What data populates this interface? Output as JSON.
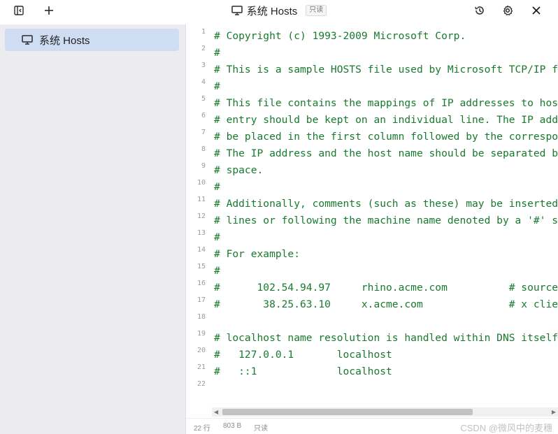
{
  "titlebar": {
    "title": "系统 Hosts",
    "readonly_badge": "只读",
    "icons": [
      "sidebar-toggle-icon",
      "plus-icon",
      "monitor-icon",
      "history-icon",
      "gear-icon",
      "close-icon"
    ]
  },
  "sidebar": {
    "items": [
      {
        "label": "系统 Hosts",
        "icon": "monitor-icon",
        "selected": true
      }
    ]
  },
  "editor": {
    "lines": [
      {
        "num": "1",
        "text": "# Copyright (c) 1993-2009 Microsoft Corp."
      },
      {
        "num": "2",
        "text": "#"
      },
      {
        "num": "3",
        "text": "# This is a sample HOSTS file used by Microsoft TCP/IP f"
      },
      {
        "num": "4",
        "text": "#"
      },
      {
        "num": "5",
        "text": "# This file contains the mappings of IP addresses to hos"
      },
      {
        "num": "6",
        "text": "# entry should be kept on an individual line. The IP add"
      },
      {
        "num": "7",
        "text": "# be placed in the first column followed by the correspo"
      },
      {
        "num": "8",
        "text": "# The IP address and the host name should be separated b"
      },
      {
        "num": "9",
        "text": "# space."
      },
      {
        "num": "10",
        "text": "#"
      },
      {
        "num": "11",
        "text": "# Additionally, comments (such as these) may be inserted"
      },
      {
        "num": "12",
        "text": "# lines or following the machine name denoted by a '#' s"
      },
      {
        "num": "13",
        "text": "#"
      },
      {
        "num": "14",
        "text": "# For example:"
      },
      {
        "num": "15",
        "text": "#"
      },
      {
        "num": "16",
        "text": "#      102.54.94.97     rhino.acme.com          # source"
      },
      {
        "num": "17",
        "text": "#       38.25.63.10     x.acme.com              # x clie"
      },
      {
        "num": "18",
        "text": ""
      },
      {
        "num": "19",
        "text": "# localhost name resolution is handled within DNS itself"
      },
      {
        "num": "20",
        "text": "#   127.0.0.1       localhost"
      },
      {
        "num": "21",
        "text": "#   ::1             localhost"
      },
      {
        "num": "22",
        "text": ""
      }
    ]
  },
  "statusbar": {
    "line_count": "22 行",
    "size": "803 B",
    "mode": "只读",
    "watermark": "CSDN @微风中的麦穗"
  },
  "colors": {
    "code_comment": "#197a2e",
    "sidebar_bg": "#ebebf0",
    "selected_item_bg": "#cfddf2"
  }
}
